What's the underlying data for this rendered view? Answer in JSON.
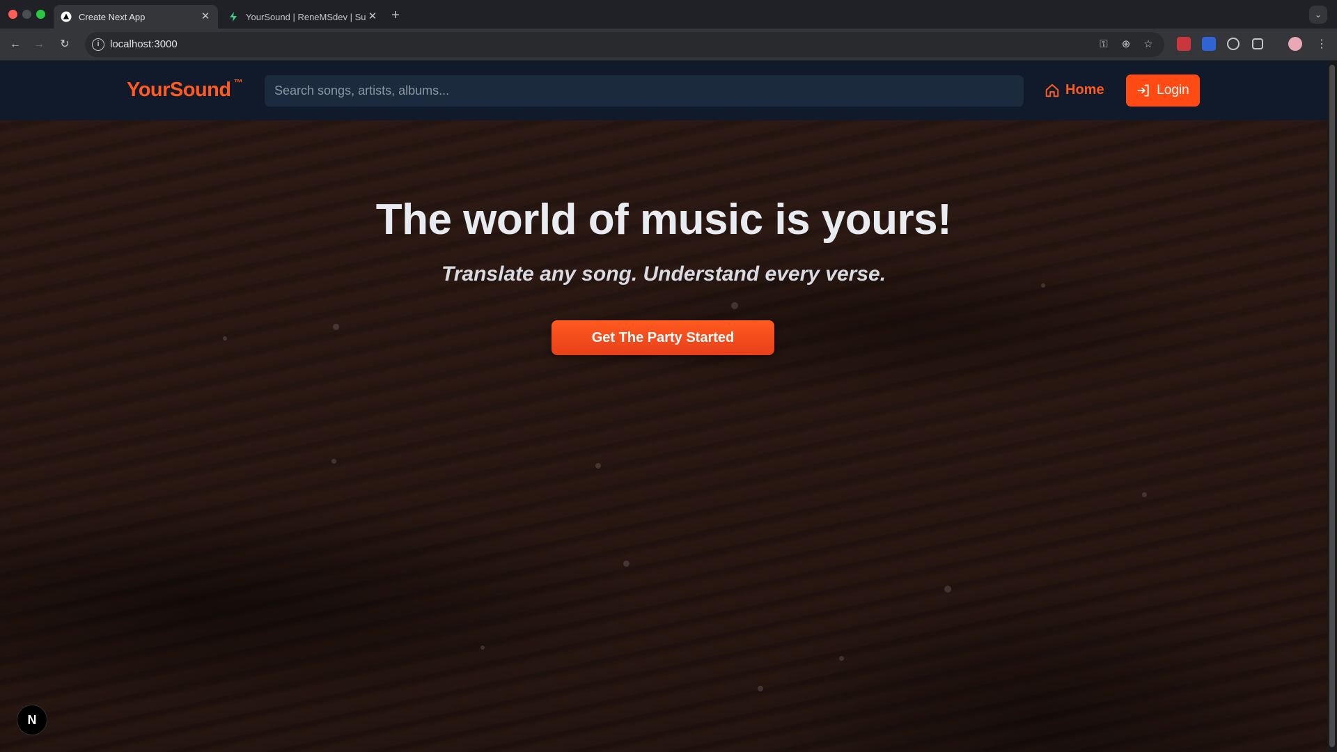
{
  "browser": {
    "tabs": [
      {
        "title": "Create Next App",
        "active": true,
        "favicon": "nextjs-triangle-icon"
      },
      {
        "title": "YourSound | ReneMSdev | Su",
        "active": false,
        "favicon": "supabase-bolt-icon"
      }
    ],
    "url": "localhost:3000"
  },
  "header": {
    "logo": "YourSound",
    "logo_mark": "™",
    "search_placeholder": "Search songs, artists, albums...",
    "home_label": "Home",
    "login_label": "Login"
  },
  "hero": {
    "title": "The world of music is yours!",
    "subtitle": "Translate any song. Understand every verse.",
    "cta_label": "Get The Party Started"
  },
  "badge": {
    "label": "N"
  },
  "colors": {
    "brand_orange": "#ff5a1f",
    "header_bg": "#101a2a",
    "search_bg": "#1b2a3c",
    "hero_text": "#e8ebf0"
  }
}
